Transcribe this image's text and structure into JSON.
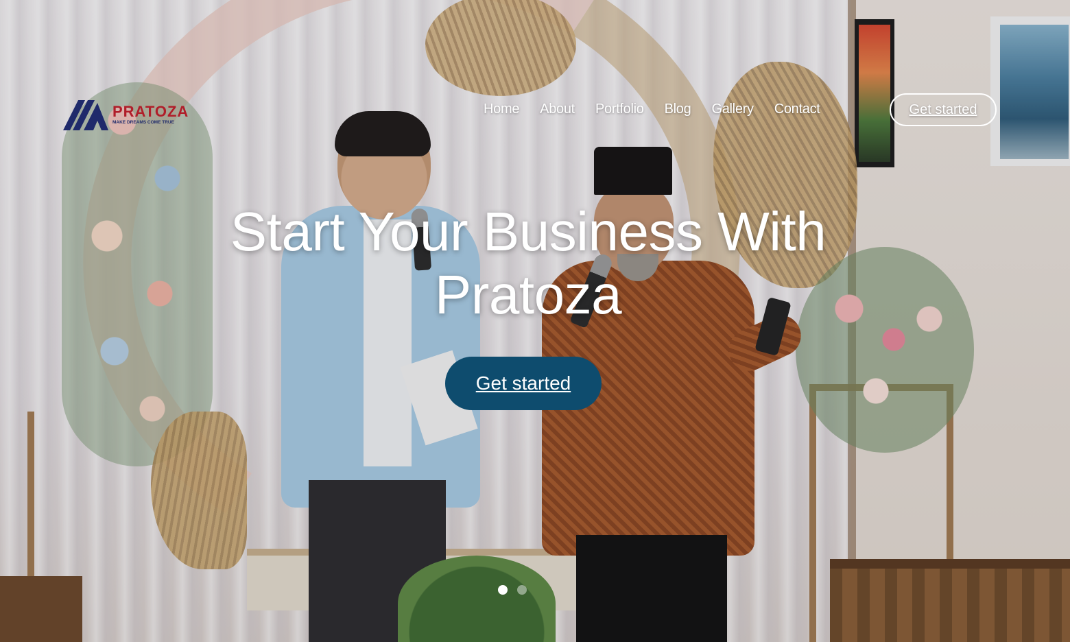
{
  "brand": {
    "name": "PRATOZA",
    "tagline": "MAKE DREAMS COME TRUE"
  },
  "nav": {
    "items": [
      {
        "label": "Home",
        "active": true
      },
      {
        "label": "About"
      },
      {
        "label": "Portfolio"
      },
      {
        "label": "Blog"
      },
      {
        "label": "Gallery"
      },
      {
        "label": "Contact"
      }
    ],
    "cta_label": "Get started"
  },
  "hero": {
    "title": "Start Your Business With Pratoza",
    "cta_label": "Get started",
    "slides": 2,
    "active_slide": 1
  },
  "colors": {
    "primary_button": "#0e4c6e",
    "logo_red": "#b01e2a",
    "logo_blue": "#1f2a6b",
    "nav_text": "#ffffff"
  },
  "icons": {
    "logo_mark": "pratoza-logo-mark"
  }
}
